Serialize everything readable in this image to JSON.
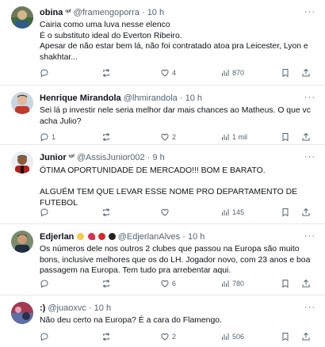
{
  "tweets": [
    {
      "name": "obina",
      "badge": "ᶜᵖᶠ",
      "handle": "@framengoporra",
      "time": "10 h",
      "text": "Cairia como uma luva nesse elenco\nÉ o substituto ideal do Everton Ribeiro.\nApesar de não estar bem lá, não foi contratado atoa pra Leicester, Lyon e shakhtar...",
      "stats": {
        "replies": "",
        "retweets": "",
        "likes": "4",
        "views": "870"
      }
    },
    {
      "name": "Henrique Mirandola",
      "handle": "@lhmirandola",
      "time": "10 h",
      "text": "Sei lá p investir nele seria melhor dar mais chances ao Matheus. O que vc acha Julio?",
      "stats": {
        "replies": "1",
        "retweets": "",
        "likes": "2",
        "views": "1 mil"
      }
    },
    {
      "name": "Junior",
      "badge": "ᶜᵖᶠ",
      "handle": "@AssisJunior002",
      "time": "9 h",
      "text": "ÓTIMA OPORTUNIDADE DE MERCADO!!! BOM E BARATO.\n\nALGUÉM TEM QUE LEVAR ESSE NOME PRO DEPARTAMENTO DE FUTEBOL",
      "stats": {
        "replies": "",
        "retweets": "",
        "likes": "",
        "views": "145"
      }
    },
    {
      "name": "Edjerlan",
      "handle": "@EdjerlanAlves",
      "time": "10 h",
      "text": "Os números dele nos outros 2 clubes que passou na Europa são muito bons, inclusive melhores que os do LH. Jogador novo, com 23 anos e boa passagem na Europa. Tem tudo pra arrebentar aqui.",
      "stats": {
        "replies": "",
        "retweets": "",
        "likes": "6",
        "views": "780"
      }
    },
    {
      "name": ":)",
      "handle": "@juaoxvc",
      "time": "10 h",
      "text": "Não deu certo na Europa? É a cara do Flamengo.",
      "stats": {
        "replies": "",
        "retweets": "",
        "likes": "2",
        "views": "506"
      }
    }
  ],
  "menu_glyph": "···",
  "colors": {
    "text": "#0f1419",
    "secondary": "#536471",
    "divider": "#e6e9ec"
  }
}
